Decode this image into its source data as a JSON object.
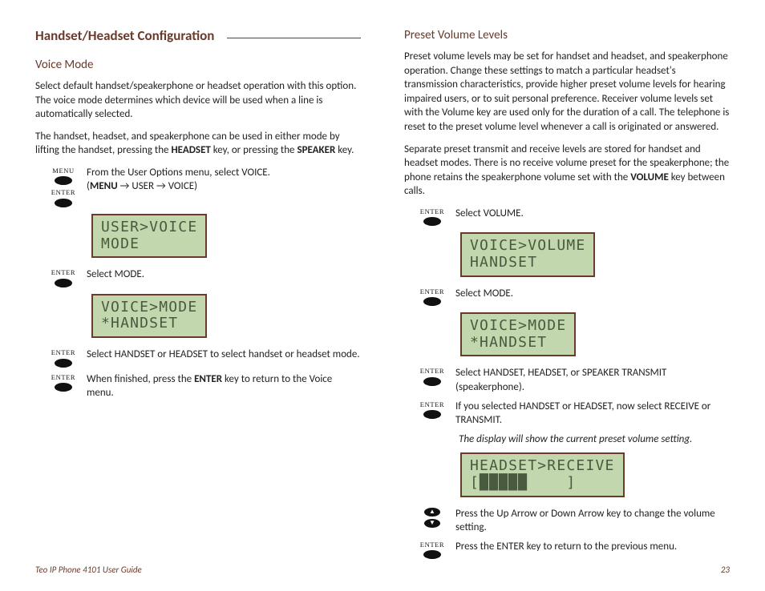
{
  "section_title": "Handset/Headset Configuration",
  "left": {
    "voice_mode_title": "Voice Mode",
    "para1": "Select default handset/speakerphone or headset operation with this option. The voice mode determines which device will be used when a line is automatically selected.",
    "para2_pre": "The handset, headset, and speakerphone can be used in either mode by lifting the handset, pressing the ",
    "para2_b1": "HEADSET",
    "para2_mid": " key, or pressing the ",
    "para2_b2": "SPEAKER",
    "para2_post": " key.",
    "step1_text": "From the User Options menu, select VOICE.",
    "step1_path_open": "(",
    "step1_path_b": "MENU",
    "step1_path_rest": " → USER → VOICE)",
    "lcd1": "USER>VOICE\nMODE",
    "step2_text": "Select MODE.",
    "lcd2": "VOICE>MODE\n*HANDSET",
    "step3_text": "Select HANDSET or HEADSET to select handset or headset mode.",
    "step4_pre": "When finished, press the ",
    "step4_b": "ENTER",
    "step4_post": " key to return to the Voice menu.",
    "key_menu": "MENU",
    "key_enter": "ENTER"
  },
  "right": {
    "preset_title": "Preset Volume Levels",
    "para1": "Preset volume levels may be set for handset and headset, and speakerphone operation. Change these settings to match a particular headset's transmission characteristics, provide higher preset volume levels for hearing impaired users, or to suit personal preference. Receiver volume levels set with the Volume key are used only for the duration of a call. The telephone is reset to the preset volume level whenever a call is originated or answered.",
    "para2_pre": "Separate preset transmit and receive levels are stored for handset and headset modes. There is no receive volume preset for the speakerphone; the phone retains the speakerphone volume set with the ",
    "para2_b": "VOLUME",
    "para2_post": " key between calls.",
    "step1_text": "Select VOLUME.",
    "lcd1": "VOICE>VOLUME\nHANDSET",
    "step2_text": "Select MODE.",
    "lcd2": "VOICE>MODE\n*HANDSET",
    "step3_text": "Select HANDSET, HEADSET, or SPEAKER TRANSMIT (speakerphone).",
    "step4_text": "If you selected HANDSET or HEADSET, now select RECEIVE or TRANSMIT.",
    "note_italic": "The display will show the current preset volume setting.",
    "lcd3": "HEADSET>RECEIVE\n[█████    ]",
    "step5_text": "Press the Up Arrow or Down Arrow key to change the volume setting.",
    "step6_text": "Press the ENTER key to return to the previous menu.",
    "key_enter": "ENTER"
  },
  "footer": {
    "left": "Teo IP Phone 4101 User Guide",
    "right": "23"
  }
}
